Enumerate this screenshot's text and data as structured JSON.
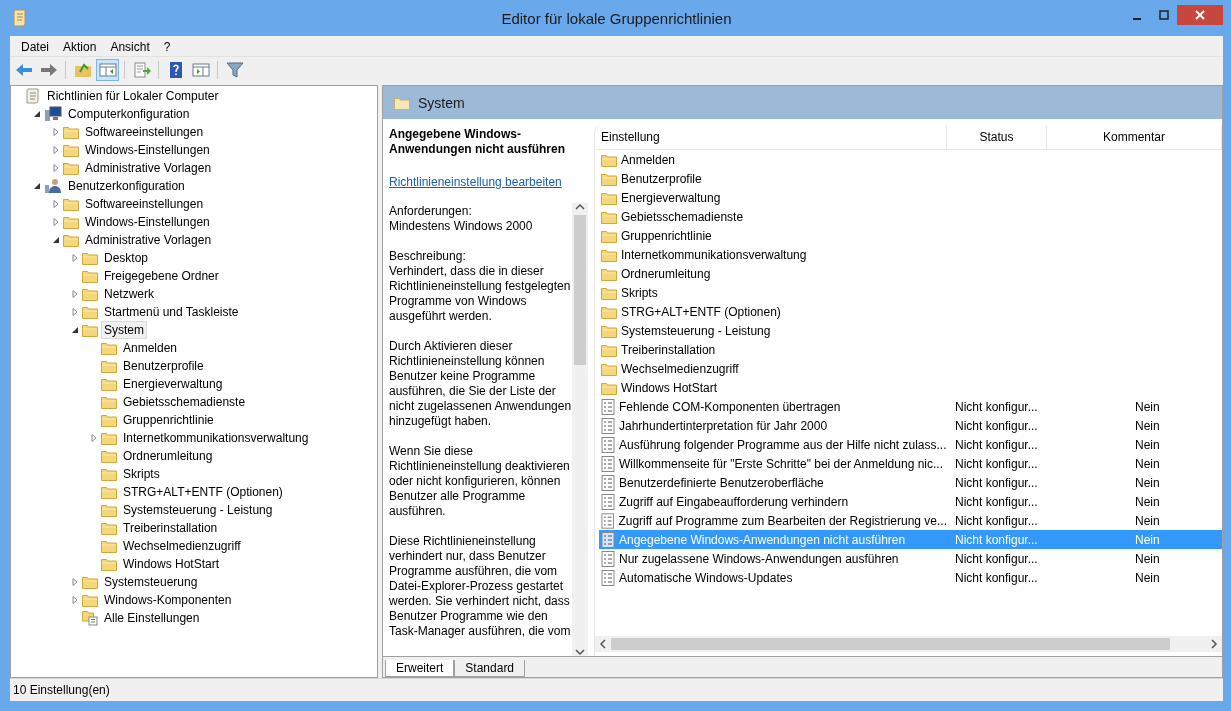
{
  "window": {
    "title": "Editor für lokale Gruppenrichtlinien"
  },
  "menu": [
    "Datei",
    "Aktion",
    "Ansicht",
    "?"
  ],
  "toolbar": [
    {
      "kind": "back",
      "pressed": false
    },
    {
      "kind": "forward",
      "pressed": false
    },
    {
      "kind": "sep"
    },
    {
      "kind": "up",
      "pressed": false
    },
    {
      "kind": "tree",
      "pressed": true
    },
    {
      "kind": "sep"
    },
    {
      "kind": "export",
      "pressed": false
    },
    {
      "kind": "sep"
    },
    {
      "kind": "help",
      "pressed": false
    },
    {
      "kind": "pane",
      "pressed": false
    },
    {
      "kind": "sep"
    },
    {
      "kind": "filter",
      "pressed": false
    }
  ],
  "tree": {
    "label": "Richtlinien für Lokaler Computer",
    "kind": "root",
    "selected": false,
    "children": [
      {
        "label": "Computerkonfiguration",
        "kind": "computer",
        "expanded": true,
        "selected": false,
        "children": [
          {
            "label": "Softwareeinstellungen",
            "kind": "folder",
            "expanded": false,
            "selected": false
          },
          {
            "label": "Windows-Einstellungen",
            "kind": "folder",
            "expanded": false,
            "selected": false
          },
          {
            "label": "Administrative Vorlagen",
            "kind": "folder",
            "expanded": false,
            "selected": false
          }
        ]
      },
      {
        "label": "Benutzerkonfiguration",
        "kind": "user",
        "expanded": true,
        "selected": false,
        "children": [
          {
            "label": "Softwareeinstellungen",
            "kind": "folder",
            "expanded": false,
            "selected": false
          },
          {
            "label": "Windows-Einstellungen",
            "kind": "folder",
            "expanded": false,
            "selected": false
          },
          {
            "label": "Administrative Vorlagen",
            "kind": "folder",
            "expanded": true,
            "selected": false,
            "children": [
              {
                "label": "Desktop",
                "kind": "folder",
                "expanded": false,
                "selected": false
              },
              {
                "label": "Freigegebene Ordner",
                "kind": "folder",
                "selected": false
              },
              {
                "label": "Netzwerk",
                "kind": "folder",
                "expanded": false,
                "selected": false
              },
              {
                "label": "Startmenü und Taskleiste",
                "kind": "folder",
                "expanded": false,
                "selected": false
              },
              {
                "label": "System",
                "kind": "folder",
                "expanded": true,
                "selected": true,
                "children": [
                  {
                    "label": "Anmelden",
                    "kind": "folder",
                    "selected": false
                  },
                  {
                    "label": "Benutzerprofile",
                    "kind": "folder",
                    "selected": false
                  },
                  {
                    "label": "Energieverwaltung",
                    "kind": "folder",
                    "selected": false
                  },
                  {
                    "label": "Gebietsschemadienste",
                    "kind": "folder",
                    "selected": false
                  },
                  {
                    "label": "Gruppenrichtlinie",
                    "kind": "folder",
                    "selected": false
                  },
                  {
                    "label": "Internetkommunikationsverwaltung",
                    "kind": "folder",
                    "expanded": false,
                    "selected": false
                  },
                  {
                    "label": "Ordnerumleitung",
                    "kind": "folder",
                    "selected": false
                  },
                  {
                    "label": "Skripts",
                    "kind": "folder",
                    "selected": false
                  },
                  {
                    "label": "STRG+ALT+ENTF (Optionen)",
                    "kind": "folder",
                    "selected": false
                  },
                  {
                    "label": "Systemsteuerung - Leistung",
                    "kind": "folder",
                    "selected": false
                  },
                  {
                    "label": "Treiberinstallation",
                    "kind": "folder",
                    "selected": false
                  },
                  {
                    "label": "Wechselmedienzugriff",
                    "kind": "folder",
                    "selected": false
                  },
                  {
                    "label": "Windows HotStart",
                    "kind": "folder",
                    "selected": false
                  }
                ]
              },
              {
                "label": "Systemsteuerung",
                "kind": "folder",
                "expanded": false,
                "selected": false
              },
              {
                "label": "Windows-Komponenten",
                "kind": "folder",
                "expanded": false,
                "selected": false
              },
              {
                "label": "Alle Einstellungen",
                "kind": "all",
                "selected": false
              }
            ]
          }
        ]
      }
    ]
  },
  "details": {
    "header": "System",
    "description": {
      "title": "Angegebene Windows-Anwendungen nicht ausführen",
      "link": "Richtlinieneinstellung bearbeiten",
      "paragraphs": [
        "Anforderungen:\nMindestens Windows 2000",
        "Beschreibung:\nVerhindert, dass die in dieser Richtlinieneinstellung festgelegten Programme von Windows ausgeführt werden.",
        "Durch Aktivieren dieser Richtlinieneinstellung können Benutzer keine Programme ausführen, die Sie der Liste der nicht zugelassenen Anwendungen hinzugefügt haben.",
        "Wenn Sie diese Richtlinieneinstellung deaktivieren oder nicht konfigurieren, können Benutzer alle Programme ausführen.",
        "Diese Richtlinieneinstellung verhindert nur, dass Benutzer Programme ausführen, die vom Datei-Explorer-Prozess gestartet werden. Sie verhindert nicht, dass Benutzer Programme wie den Task-Manager ausführen, die vom"
      ]
    },
    "table": {
      "columns": [
        "Einstellung",
        "Status",
        "Kommentar"
      ],
      "rows": [
        {
          "kind": "folder",
          "name": "Anmelden",
          "selected": false
        },
        {
          "kind": "folder",
          "name": "Benutzerprofile",
          "selected": false
        },
        {
          "kind": "folder",
          "name": "Energieverwaltung",
          "selected": false
        },
        {
          "kind": "folder",
          "name": "Gebietsschemadienste",
          "selected": false
        },
        {
          "kind": "folder",
          "name": "Gruppenrichtlinie",
          "selected": false
        },
        {
          "kind": "folder",
          "name": "Internetkommunikationsverwaltung",
          "selected": false
        },
        {
          "kind": "folder",
          "name": "Ordnerumleitung",
          "selected": false
        },
        {
          "kind": "folder",
          "name": "Skripts",
          "selected": false
        },
        {
          "kind": "folder",
          "name": "STRG+ALT+ENTF (Optionen)",
          "selected": false
        },
        {
          "kind": "folder",
          "name": "Systemsteuerung - Leistung",
          "selected": false
        },
        {
          "kind": "folder",
          "name": "Treiberinstallation",
          "selected": false
        },
        {
          "kind": "folder",
          "name": "Wechselmedienzugriff",
          "selected": false
        },
        {
          "kind": "folder",
          "name": "Windows HotStart",
          "selected": false
        },
        {
          "kind": "setting",
          "name": "Fehlende COM-Komponenten übertragen",
          "status": "Nicht konfigur...",
          "comment": "Nein",
          "selected": false
        },
        {
          "kind": "setting",
          "name": "Jahrhundertinterpretation für Jahr 2000",
          "status": "Nicht konfigur...",
          "comment": "Nein",
          "selected": false
        },
        {
          "kind": "setting",
          "name": "Ausführung folgender Programme aus der Hilfe nicht zulass...",
          "status": "Nicht konfigur...",
          "comment": "Nein",
          "selected": false
        },
        {
          "kind": "setting",
          "name": "Willkommenseite für \"Erste Schritte\" bei der Anmeldung nic...",
          "status": "Nicht konfigur...",
          "comment": "Nein",
          "selected": false
        },
        {
          "kind": "setting",
          "name": "Benutzerdefinierte Benutzeroberfläche",
          "status": "Nicht konfigur...",
          "comment": "Nein",
          "selected": false
        },
        {
          "kind": "setting",
          "name": "Zugriff auf Eingabeaufforderung verhindern",
          "status": "Nicht konfigur...",
          "comment": "Nein",
          "selected": false
        },
        {
          "kind": "setting",
          "name": "Zugriff auf Programme zum Bearbeiten der Registrierung ve...",
          "status": "Nicht konfigur...",
          "comment": "Nein",
          "selected": false
        },
        {
          "kind": "setting",
          "name": "Angegebene Windows-Anwendungen nicht ausführen",
          "status": "Nicht konfigur...",
          "comment": "Nein",
          "selected": true
        },
        {
          "kind": "setting",
          "name": "Nur zugelassene Windows-Anwendungen ausführen",
          "status": "Nicht konfigur...",
          "comment": "Nein",
          "selected": false
        },
        {
          "kind": "setting",
          "name": "Automatische Windows-Updates",
          "status": "Nicht konfigur...",
          "comment": "Nein",
          "selected": false
        }
      ]
    },
    "tabs": [
      {
        "label": "Erweitert",
        "selected": true
      },
      {
        "label": "Standard",
        "selected": false
      }
    ]
  },
  "status_bar": "10 Einstellung(en)"
}
